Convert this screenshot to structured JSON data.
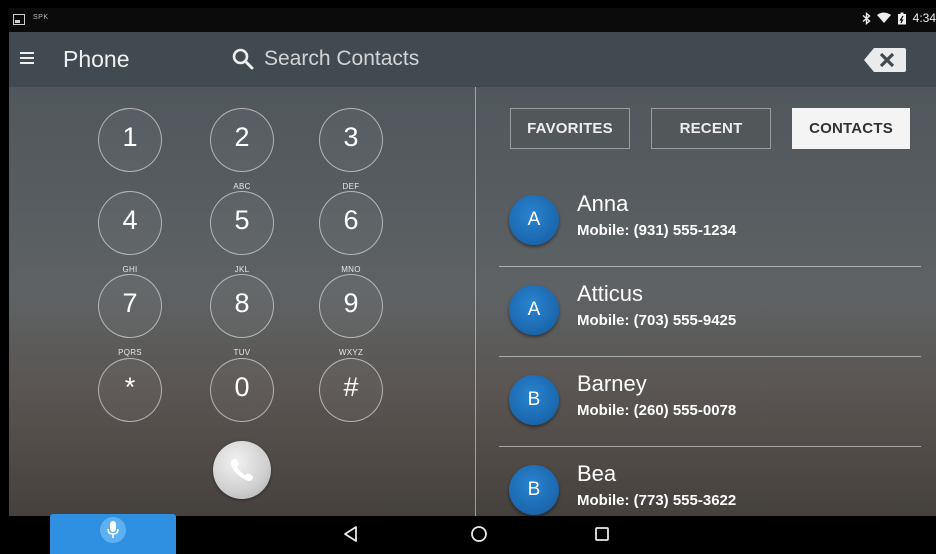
{
  "status_bar": {
    "app_label": "SPK",
    "time": "4:34",
    "icons": [
      "notification-icon",
      "bluetooth-icon",
      "wifi-icon",
      "battery-icon"
    ]
  },
  "app_bar": {
    "title": "Phone",
    "search_placeholder": "Search Contacts"
  },
  "dialpad": {
    "keys": [
      {
        "digit": "1",
        "letters": ""
      },
      {
        "digit": "2",
        "letters": "ABC"
      },
      {
        "digit": "3",
        "letters": "DEF"
      },
      {
        "digit": "4",
        "letters": "GHI"
      },
      {
        "digit": "5",
        "letters": "JKL"
      },
      {
        "digit": "6",
        "letters": "MNO"
      },
      {
        "digit": "7",
        "letters": "PQRS"
      },
      {
        "digit": "8",
        "letters": "TUV"
      },
      {
        "digit": "9",
        "letters": "WXYZ"
      },
      {
        "digit": "*",
        "letters": ""
      },
      {
        "digit": "0",
        "letters": ""
      },
      {
        "digit": "#",
        "letters": ""
      }
    ]
  },
  "tabs": [
    {
      "label": "FAVORITES",
      "selected": false
    },
    {
      "label": "RECENT",
      "selected": false
    },
    {
      "label": "CONTACTS",
      "selected": true
    }
  ],
  "contacts": [
    {
      "initial": "A",
      "name": "Anna",
      "number": "Mobile:  (931) 555-1234"
    },
    {
      "initial": "A",
      "name": "Atticus",
      "number": "Mobile:  (703) 555-9425"
    },
    {
      "initial": "B",
      "name": "Barney",
      "number": "Mobile:  (260) 555-0078"
    },
    {
      "initial": "B",
      "name": "Bea",
      "number": "Mobile:  (773) 555-3622"
    }
  ],
  "colors": {
    "accent": "#2f8fe0",
    "avatar": "#1a66ad",
    "app_bar": "#414a50",
    "selected_tab": "#f4f4f4"
  }
}
